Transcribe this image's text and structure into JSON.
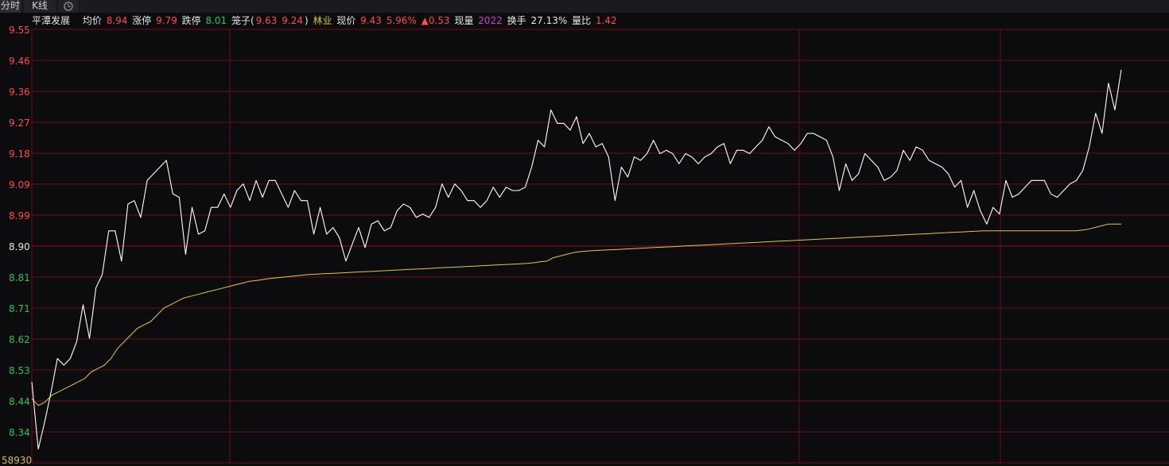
{
  "tabs": [
    {
      "label": "分时",
      "active": true
    },
    {
      "label": "K线",
      "active": false
    },
    {
      "label": "history-icon",
      "active": false
    }
  ],
  "info": {
    "name": "平潭发展",
    "avg_label": "均价",
    "avg_value": "8.94",
    "limit_up_label": "涨停",
    "limit_up_value": "9.79",
    "limit_down_label": "跌停",
    "limit_down_value": "8.01",
    "cage_label": "笼子(",
    "cage_high": "9.63",
    "cage_low": "9.24",
    "cage_close": ")",
    "sector": "林业",
    "price_label": "现价",
    "price_value": "9.43",
    "pct_change": "5.96%",
    "change": "▲0.53",
    "volume_label": "现量",
    "volume_value": "2022",
    "turnover_label": "换手",
    "turnover_value": "27.13%",
    "ratio_label": "量比",
    "ratio_value": "1.42"
  },
  "colors": {
    "background": "#0c0c0e",
    "grid": "#6a0d12",
    "price_line": "#ffffff",
    "avg_line": "#e0c84a",
    "up": "#ff4a4a",
    "down": "#22c55e"
  },
  "chart_data": {
    "type": "line",
    "ylim": [
      8.25,
      9.55
    ],
    "reference_price": 8.9,
    "y_ticks": [
      "9.55",
      "9.46",
      "9.36",
      "9.27",
      "9.18",
      "9.09",
      "8.99",
      "8.90",
      "8.81",
      "8.71",
      "8.62",
      "8.53",
      "8.44",
      "8.34"
    ],
    "bottom_label": "58930",
    "series": [
      {
        "values": [
          8.5,
          8.3,
          8.38,
          8.47,
          8.57,
          8.55,
          8.57,
          8.62,
          8.73,
          8.63,
          8.78,
          8.82,
          8.95,
          8.95,
          8.86,
          9.03,
          9.04,
          8.99,
          9.1,
          9.12,
          9.14,
          9.16,
          9.06,
          9.05,
          8.88,
          9.02,
          8.94,
          8.95,
          9.02,
          9.02,
          9.06,
          9.02,
          9.07,
          9.09,
          9.04,
          9.1,
          9.05,
          9.1,
          9.1,
          9.06,
          9.02,
          9.07,
          9.04,
          9.04,
          8.94,
          9.02,
          8.94,
          8.96,
          8.93,
          8.86,
          8.91,
          8.96,
          8.9,
          8.97,
          8.98,
          8.95,
          8.96,
          9.01,
          9.03,
          9.02,
          8.99,
          9.0,
          8.99,
          9.02,
          9.09,
          9.05,
          9.09,
          9.07,
          9.04,
          9.04,
          9.02,
          9.04,
          9.08,
          9.05,
          9.08,
          9.07,
          9.07,
          9.08,
          9.14,
          9.22,
          9.2,
          9.31,
          9.27,
          9.27,
          9.25,
          9.29,
          9.21,
          9.24,
          9.2,
          9.21,
          9.17,
          9.04,
          9.14,
          9.11,
          9.17,
          9.16,
          9.18,
          9.22,
          9.18,
          9.19,
          9.18,
          9.15,
          9.18,
          9.17,
          9.15,
          9.17,
          9.18,
          9.2,
          9.21,
          9.15,
          9.19,
          9.19,
          9.18,
          9.2,
          9.22,
          9.26,
          9.23,
          9.22,
          9.21,
          9.19,
          9.21,
          9.24,
          9.24,
          9.23,
          9.22,
          9.17,
          9.07,
          9.15,
          9.1,
          9.12,
          9.18,
          9.16,
          9.14,
          9.1,
          9.11,
          9.13,
          9.19,
          9.16,
          9.2,
          9.19,
          9.16,
          9.15,
          9.14,
          9.12,
          9.08,
          9.1,
          9.02,
          9.07,
          9.01,
          8.97,
          9.02,
          9.0,
          9.1,
          9.05,
          9.06,
          9.08,
          9.1,
          9.1,
          9.1,
          9.06,
          9.05,
          9.07,
          9.09,
          9.1,
          9.13,
          9.2,
          9.3,
          9.24,
          9.39,
          9.31,
          9.43
        ]
      },
      {
        "values": [
          8.45,
          8.43,
          8.44,
          8.46,
          8.47,
          8.48,
          8.49,
          8.5,
          8.51,
          8.53,
          8.54,
          8.55,
          8.57,
          8.6,
          8.62,
          8.64,
          8.66,
          8.67,
          8.68,
          8.7,
          8.72,
          8.73,
          8.74,
          8.75,
          8.755,
          8.76,
          8.765,
          8.77,
          8.775,
          8.78,
          8.785,
          8.79,
          8.795,
          8.8,
          8.802,
          8.805,
          8.808,
          8.81,
          8.812,
          8.814,
          8.816,
          8.818,
          8.82,
          8.821,
          8.822,
          8.823,
          8.824,
          8.825,
          8.826,
          8.827,
          8.828,
          8.829,
          8.83,
          8.831,
          8.832,
          8.833,
          8.834,
          8.835,
          8.836,
          8.837,
          8.838,
          8.839,
          8.84,
          8.841,
          8.842,
          8.843,
          8.844,
          8.845,
          8.846,
          8.847,
          8.848,
          8.849,
          8.85,
          8.851,
          8.852,
          8.853,
          8.855,
          8.858,
          8.86,
          8.87,
          8.875,
          8.88,
          8.885,
          8.888,
          8.89,
          8.891,
          8.892,
          8.893,
          8.894,
          8.895,
          8.896,
          8.897,
          8.898,
          8.899,
          8.9,
          8.901,
          8.902,
          8.903,
          8.904,
          8.905,
          8.906,
          8.907,
          8.908,
          8.909,
          8.91,
          8.911,
          8.912,
          8.913,
          8.914,
          8.915,
          8.916,
          8.917,
          8.918,
          8.919,
          8.92,
          8.921,
          8.922,
          8.923,
          8.924,
          8.925,
          8.926,
          8.927,
          8.928,
          8.929,
          8.93,
          8.931,
          8.932,
          8.933,
          8.934,
          8.935,
          8.936,
          8.937,
          8.938,
          8.939,
          8.94,
          8.941,
          8.942,
          8.943,
          8.944,
          8.945,
          8.946,
          8.947,
          8.948,
          8.949,
          8.95,
          8.95,
          8.95,
          8.95,
          8.95,
          8.95,
          8.95,
          8.95,
          8.95,
          8.95,
          8.95,
          8.95,
          8.95,
          8.95,
          8.95,
          8.952,
          8.955,
          8.96,
          8.965,
          8.97,
          8.97,
          8.97
        ]
      }
    ]
  }
}
